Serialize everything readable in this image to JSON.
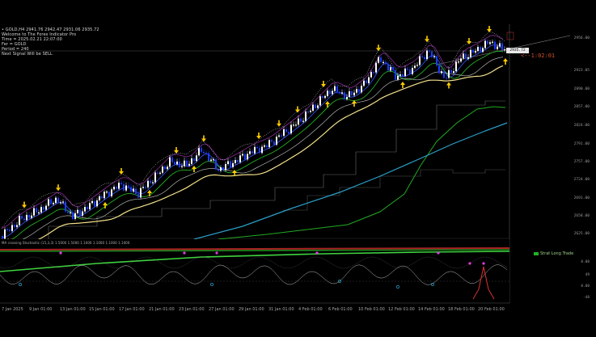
{
  "symbol_info": {
    "line1": "• GOLD,H4  2941.76 2942.47 2931.06 2935.72",
    "line2": "Welcome to The Forex Indicator Pro",
    "line3": "Time = 2025.02.21 22:07:00",
    "line4": "Fer = GOLD",
    "line5": "Period = 240",
    "line6": "Next Signal Will be SELL"
  },
  "price_axis": [
    "2956.00",
    "2923.05",
    "2890.00",
    "2857.00",
    "2824.00",
    "2791.00",
    "2757.00",
    "2724.00",
    "2691.00",
    "2658.00",
    "2625.00"
  ],
  "current_price": "2935.72",
  "countdown": "<--1:02:01",
  "indicator_header": "MA crossing Stochastic (15,3,3) 1.5000 1.5000 1.1000 1.1000 1.1000 1.1000",
  "indicator_legend": "Strat Long Trade",
  "indicator_axis": [
    "0.00",
    "49",
    "0.00",
    "-48"
  ],
  "time_axis": [
    "7 Jan 2025",
    "9 Jan 01:00",
    "13 Jan 01:00",
    "15 Jan 01:00",
    "17 Jan 01:00",
    "21 Jan 01:00",
    "23 Jan 01:00",
    "27 Jan 01:00",
    "29 Jan 01:00",
    "31 Jan 01:00",
    "4 Feb 01:00",
    "6 Feb 01:00",
    "10 Feb 01:00",
    "12 Feb 01:00",
    "14 Feb 01:00",
    "18 Feb 01:00",
    "20 Feb 01:00"
  ],
  "colors": {
    "background": "#000000",
    "bull_candle": "#ffffff",
    "bear_candle": "#1e3cff",
    "signal_arrow": "#ffcc00",
    "ma_yellow": "#f2e08a",
    "ma_green": "#22aa22",
    "ma_cyan": "#2aa0c8",
    "ma_blue": "#3355ff",
    "ma_purple": "#8a2a9a",
    "countdown": "#d2522a"
  }
}
